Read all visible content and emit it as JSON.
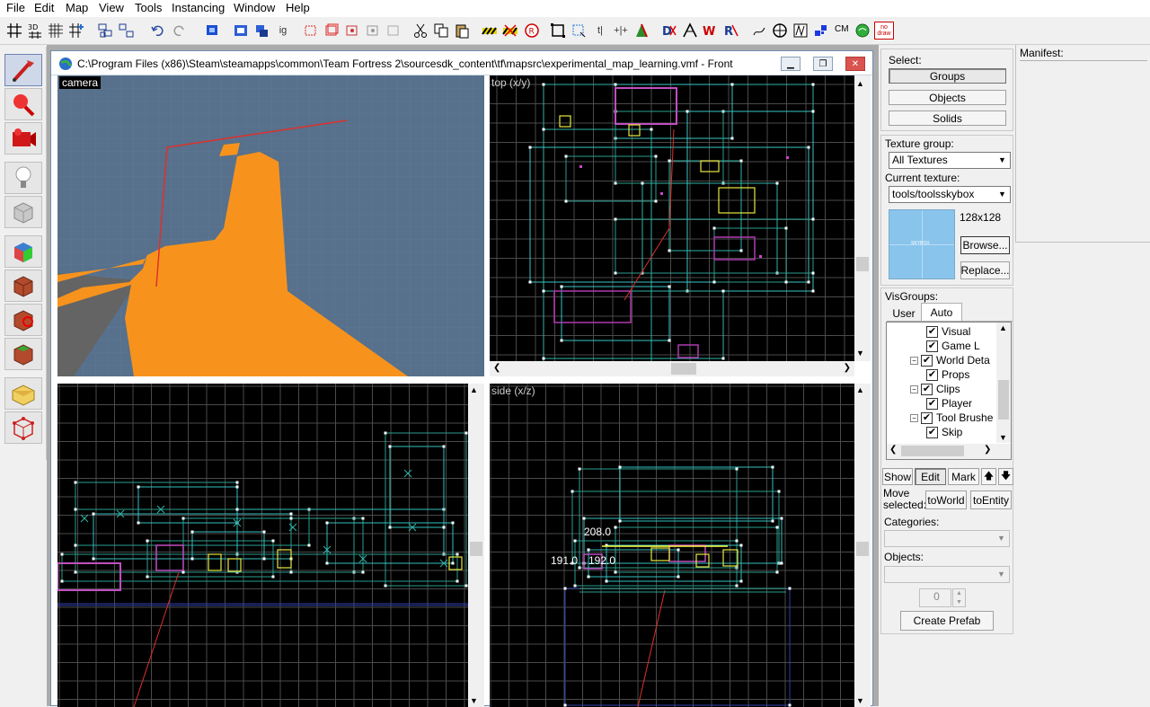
{
  "menu": [
    "File",
    "Edit",
    "Map",
    "View",
    "Tools",
    "Instancing",
    "Window",
    "Help"
  ],
  "toolbar": {
    "cm_label": "CM",
    "nodraw_label": "no draw"
  },
  "document": {
    "title": "C:\\Program Files (x86)\\Steam\\steamapps\\common\\Team Fortress 2\\sourcesdk_content\\tf\\mapsrc\\experimental_map_learning.vmf - Front"
  },
  "viewports": {
    "camera": "camera",
    "top": "top (x/y)",
    "side": "side (x/z)",
    "front_labels": [],
    "side_labels": [
      "208.0",
      "191.0",
      "192.0"
    ]
  },
  "select": {
    "label": "Select:",
    "groups": "Groups",
    "objects": "Objects",
    "solids": "Solids"
  },
  "texture": {
    "group_label": "Texture group:",
    "group_value": "All Textures",
    "current_label": "Current texture:",
    "current_value": "tools/toolsskybox",
    "size": "128x128",
    "browse": "Browse...",
    "replace": "Replace...",
    "preview_text": "SKYBOX"
  },
  "visgroups": {
    "label": "VisGroups:",
    "tabs": [
      "User",
      "Auto"
    ],
    "items": [
      {
        "label": "Visual",
        "level": 2,
        "checked": true
      },
      {
        "label": "Game L",
        "level": 2,
        "checked": true
      },
      {
        "label": "World Deta",
        "level": 1,
        "checked": true,
        "expander": "−"
      },
      {
        "label": "Props",
        "level": 2,
        "checked": true
      },
      {
        "label": "Clips",
        "level": 1,
        "checked": true,
        "expander": "−"
      },
      {
        "label": "Player",
        "level": 2,
        "checked": true
      },
      {
        "label": "Tool Brushe",
        "level": 1,
        "checked": true,
        "expander": "−"
      },
      {
        "label": "Skip",
        "level": 2,
        "checked": true
      }
    ],
    "show": "Show",
    "edit": "Edit",
    "mark": "Mark"
  },
  "move": {
    "label_line1": "Move",
    "label_line2": "selected:",
    "to_world": "toWorld",
    "to_entity": "toEntity"
  },
  "prefab": {
    "categories_label": "Categories:",
    "objects_label": "Objects:",
    "count": "0",
    "create": "Create Prefab"
  },
  "manifest": {
    "label": "Manifest:"
  },
  "colors": {
    "orange": "#f7941d",
    "sky": "#4f6a86",
    "grid": "#4a4a4a",
    "cyan": "#36c8c8",
    "white_handle": "#ffffff",
    "magenta": "#c040c0",
    "yellow": "#e8e840",
    "red_line": "#e0302a"
  }
}
